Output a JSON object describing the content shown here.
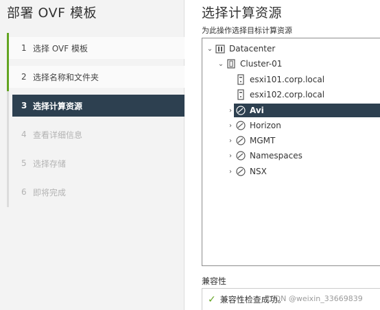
{
  "wizard": {
    "title": "部署 OVF 模板",
    "steps": [
      {
        "num": "1",
        "label": "选择 OVF 模板",
        "state": "completed"
      },
      {
        "num": "2",
        "label": "选择名称和文件夹",
        "state": "completed"
      },
      {
        "num": "3",
        "label": "选择计算资源",
        "state": "active"
      },
      {
        "num": "4",
        "label": "查看详细信息",
        "state": "pending"
      },
      {
        "num": "5",
        "label": "选择存储",
        "state": "pending"
      },
      {
        "num": "6",
        "label": "即将完成",
        "state": "pending"
      }
    ]
  },
  "main": {
    "title": "选择计算资源",
    "subtitle": "为此操作选择目标计算资源",
    "tree": {
      "datacenter": {
        "label": "Datacenter",
        "icon": "datacenter-icon",
        "expanded": true
      },
      "cluster": {
        "label": "Cluster-01",
        "icon": "cluster-icon",
        "expanded": true
      },
      "hosts": [
        {
          "label": "esxi101.corp.local",
          "icon": "host-icon"
        },
        {
          "label": "esxi102.corp.local",
          "icon": "host-icon"
        }
      ],
      "resource_pools": [
        {
          "label": "Avi",
          "icon": "resource-pool-icon",
          "selected": true
        },
        {
          "label": "Horizon",
          "icon": "resource-pool-icon",
          "selected": false
        },
        {
          "label": "MGMT",
          "icon": "resource-pool-icon",
          "selected": false
        },
        {
          "label": "Namespaces",
          "icon": "resource-pool-icon",
          "selected": false
        },
        {
          "label": "NSX",
          "icon": "resource-pool-icon",
          "selected": false
        }
      ]
    },
    "compatibility": {
      "label": "兼容性",
      "status": "兼容性检查成功。",
      "status_icon": "check-icon"
    }
  },
  "watermark": "CSDN @weixin_33669839",
  "colors": {
    "accent_dark": "#2d4050",
    "success_green": "#62a420",
    "panel_bg": "#f3f3f3"
  }
}
